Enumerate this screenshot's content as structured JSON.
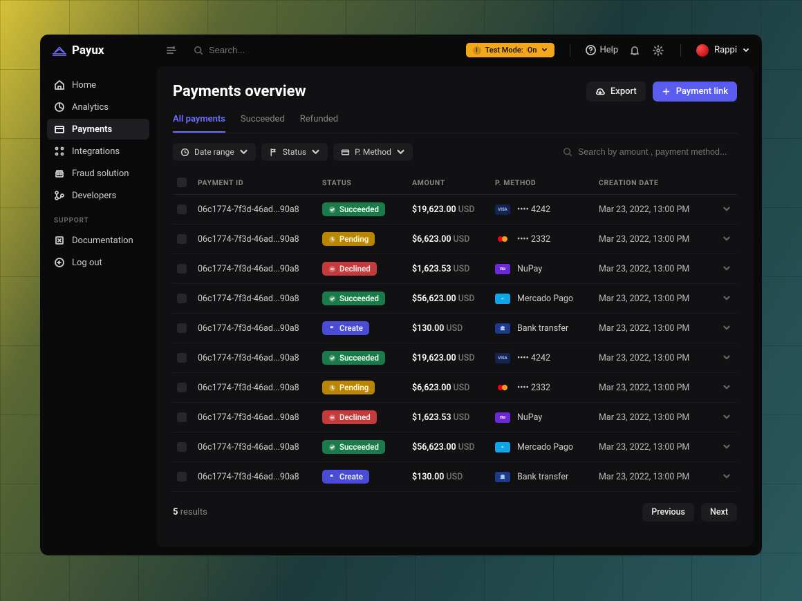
{
  "brand": "Payux",
  "search_placeholder": "Search...",
  "test_mode": {
    "label": "Test Mode:",
    "state": "On"
  },
  "help_label": "Help",
  "user": {
    "name": "Rappi"
  },
  "sidebar": {
    "items": [
      {
        "label": "Home"
      },
      {
        "label": "Analytics"
      },
      {
        "label": "Payments"
      },
      {
        "label": "Integrations"
      },
      {
        "label": "Fraud solution"
      },
      {
        "label": "Developers"
      }
    ],
    "support_header": "SUPPORT",
    "support_items": [
      {
        "label": "Documentation"
      },
      {
        "label": "Log out"
      }
    ]
  },
  "page": {
    "title": "Payments overview",
    "export_label": "Export",
    "payment_link_label": "Payment link"
  },
  "tabs": [
    {
      "label": "All payments"
    },
    {
      "label": "Succeeded"
    },
    {
      "label": "Refunded"
    }
  ],
  "filters": {
    "date_range": "Date range",
    "status": "Status",
    "method": "P. Method",
    "search_placeholder": "Search by amount , payment method..."
  },
  "columns": {
    "id": "PAYMENT ID",
    "status": "STATUS",
    "amount": "AMOUNT",
    "method": "P. METHOD",
    "date": "CREATION DATE"
  },
  "rows": [
    {
      "id": "06c1774-7f3d-46ad...90a8",
      "status": "Succeeded",
      "status_class": "b-succeeded",
      "status_icon": "check",
      "amount": "$19,623.00",
      "currency": "USD",
      "method_kind": "visa",
      "method_label": "•••• 4242",
      "date": "Mar 23, 2022, 13:00 PM"
    },
    {
      "id": "06c1774-7f3d-46ad...90a8",
      "status": "Pending",
      "status_class": "b-pending",
      "status_icon": "clock",
      "amount": "$6,623.00",
      "currency": "USD",
      "method_kind": "mc",
      "method_label": "•••• 2332",
      "date": "Mar 23, 2022, 13:00 PM"
    },
    {
      "id": "06c1774-7f3d-46ad...90a8",
      "status": "Declined",
      "status_class": "b-declined",
      "status_icon": "minus",
      "amount": "$1,623.53",
      "currency": "USD",
      "method_kind": "nu",
      "method_label": "NuPay",
      "date": "Mar 23, 2022, 13:00 PM"
    },
    {
      "id": "06c1774-7f3d-46ad...90a8",
      "status": "Succeeded",
      "status_class": "b-succeeded",
      "status_icon": "check",
      "amount": "$56,623.00",
      "currency": "USD",
      "method_kind": "mp",
      "method_label": "Mercado Pago",
      "date": "Mar 23, 2022, 13:00 PM"
    },
    {
      "id": "06c1774-7f3d-46ad...90a8",
      "status": "Create",
      "status_class": "b-create",
      "status_icon": "flag",
      "amount": "$130.00",
      "currency": "USD",
      "method_kind": "bank",
      "method_label": "Bank transfer",
      "date": "Mar 23, 2022, 13:00 PM"
    },
    {
      "id": "06c1774-7f3d-46ad...90a8",
      "status": "Succeeded",
      "status_class": "b-succeeded",
      "status_icon": "check",
      "amount": "$19,623.00",
      "currency": "USD",
      "method_kind": "visa",
      "method_label": "•••• 4242",
      "date": "Mar 23, 2022, 13:00 PM"
    },
    {
      "id": "06c1774-7f3d-46ad...90a8",
      "status": "Pending",
      "status_class": "b-pending",
      "status_icon": "clock",
      "amount": "$6,623.00",
      "currency": "USD",
      "method_kind": "mc",
      "method_label": "•••• 2332",
      "date": "Mar 23, 2022, 13:00 PM"
    },
    {
      "id": "06c1774-7f3d-46ad...90a8",
      "status": "Declined",
      "status_class": "b-declined",
      "status_icon": "minus",
      "amount": "$1,623.53",
      "currency": "USD",
      "method_kind": "nu",
      "method_label": "NuPay",
      "date": "Mar 23, 2022, 13:00 PM"
    },
    {
      "id": "06c1774-7f3d-46ad...90a8",
      "status": "Succeeded",
      "status_class": "b-succeeded",
      "status_icon": "check",
      "amount": "$56,623.00",
      "currency": "USD",
      "method_kind": "mp",
      "method_label": "Mercado Pago",
      "date": "Mar 23, 2022, 13:00 PM"
    },
    {
      "id": "06c1774-7f3d-46ad...90a8",
      "status": "Create",
      "status_class": "b-create",
      "status_icon": "flag",
      "amount": "$130.00",
      "currency": "USD",
      "method_kind": "bank",
      "method_label": "Bank transfer",
      "date": "Mar 23, 2022, 13:00 PM"
    }
  ],
  "footer": {
    "results_count": "5",
    "results_word": "results",
    "prev": "Previous",
    "next": "Next"
  }
}
